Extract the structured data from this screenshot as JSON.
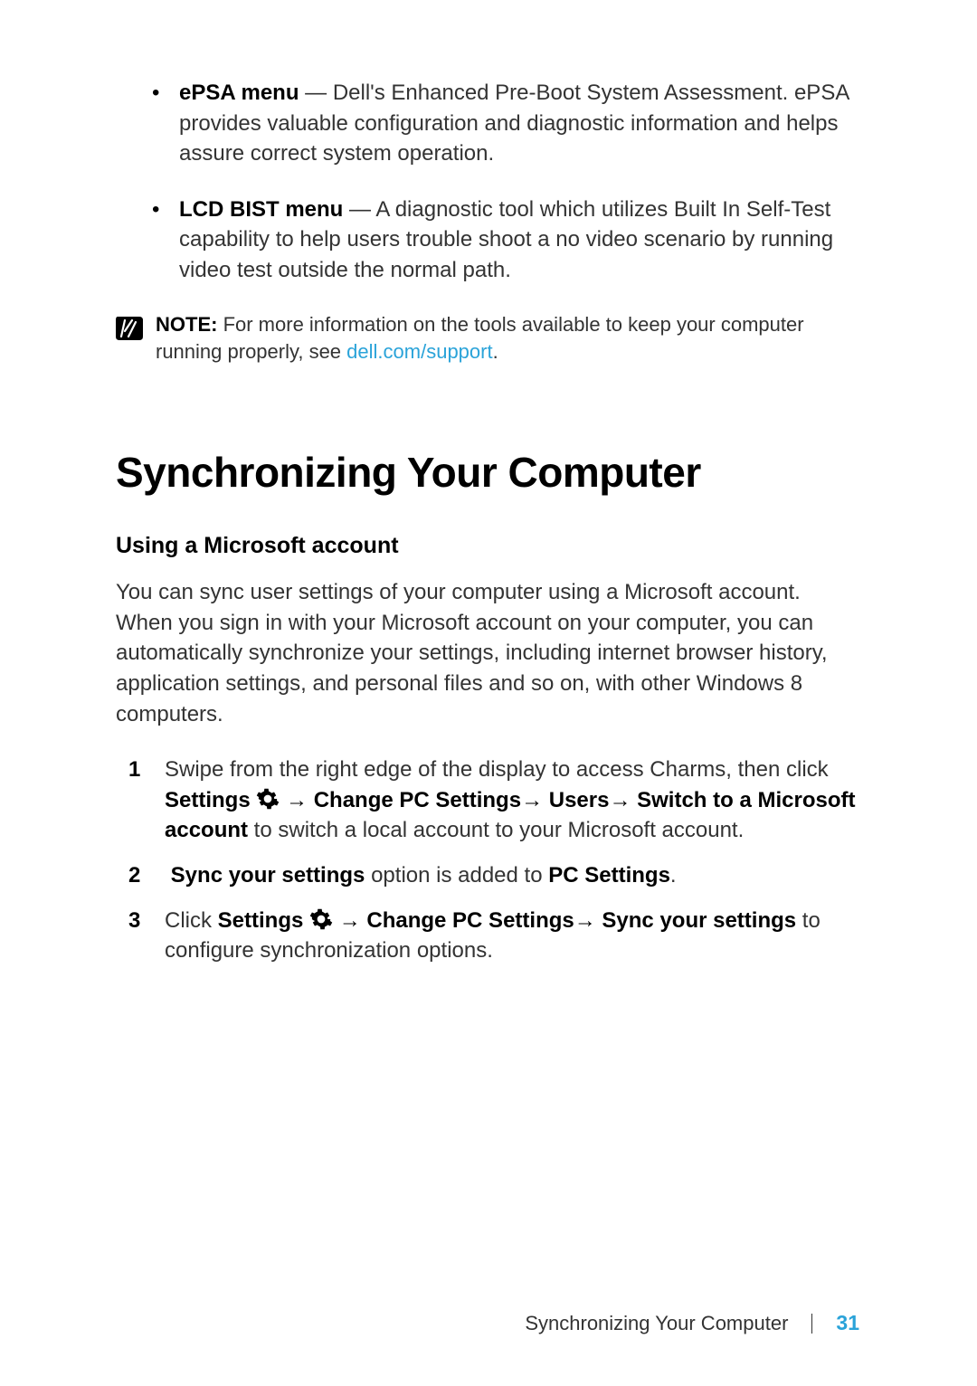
{
  "bullets": {
    "epsa": {
      "title": "ePSA menu",
      "text": " — Dell's Enhanced Pre-Boot System Assessment. ePSA provides valuable configuration and diagnostic information and helps assure correct system operation."
    },
    "lcd": {
      "title": "LCD BIST menu",
      "text": " — A diagnostic tool which utilizes Built In Self-Test capability to help users trouble shoot a no video scenario by running video test outside the normal path."
    }
  },
  "note": {
    "label": "NOTE:",
    "text_before": " For more information on the tools available to keep your computer running properly, see ",
    "link": "dell.com/support",
    "text_after": "."
  },
  "heading": "Synchronizing Your Computer",
  "subheading": "Using a Microsoft account",
  "intro": "You can sync user settings of your computer using a Microsoft account. When you sign in with your Microsoft account on your computer, you can automatically synchronize your settings, including internet browser history, application settings, and personal files and so on, with other Windows 8 computers.",
  "steps": {
    "s1": {
      "num": "1",
      "a": "Swipe from the right edge of the display to access Charms, then click ",
      "b": "Settings",
      "arrow1": " → ",
      "c": "Change PC Settings",
      "arrow2": "→ ",
      "d": "Users",
      "arrow3": "→ ",
      "e": "Switch to a Microsoft account",
      "f": " to switch a local account to your Microsoft account."
    },
    "s2": {
      "num": "2",
      "a": "Sync your settings",
      "b": " option is added to ",
      "c": "PC Settings",
      "d": "."
    },
    "s3": {
      "num": "3",
      "a": "Click ",
      "b": "Settings",
      "arrow1": " → ",
      "c": "Change PC Settings",
      "arrow2": "→  ",
      "d": "Sync your settings",
      "e": " to configure synchronization options."
    }
  },
  "footer": {
    "label": "Synchronizing Your Computer",
    "page": "31"
  }
}
